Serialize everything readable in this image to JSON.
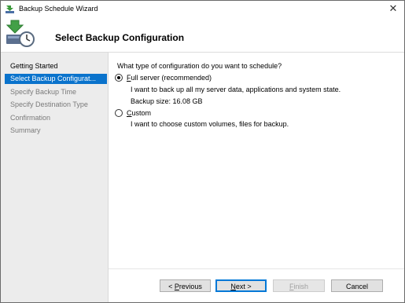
{
  "window": {
    "title": "Backup Schedule Wizard",
    "close_glyph": "✕"
  },
  "header": {
    "title": "Select Backup Configuration",
    "icon": "backup-clock-icon"
  },
  "sidebar": {
    "items": [
      {
        "label": "Getting Started",
        "state": "visited"
      },
      {
        "label": "Select Backup Configurat...",
        "state": "selected"
      },
      {
        "label": "Specify Backup Time",
        "state": "pending"
      },
      {
        "label": "Specify Destination Type",
        "state": "pending"
      },
      {
        "label": "Confirmation",
        "state": "pending"
      },
      {
        "label": "Summary",
        "state": "pending"
      }
    ]
  },
  "main": {
    "question": "What type of configuration do you want to schedule?",
    "options": [
      {
        "label_first": "F",
        "label_rest": "ull server (recommended)",
        "checked": true,
        "description": "I want to back up all my server data, applications and system state.",
        "detail": "Backup size: 16.08 GB"
      },
      {
        "label_first": "C",
        "label_rest": "ustom",
        "checked": false,
        "description": "I want to choose custom volumes, files for backup."
      }
    ]
  },
  "buttons": {
    "previous": {
      "prefix": "< ",
      "accel": "P",
      "rest": "revious"
    },
    "next": {
      "accel": "N",
      "rest": "ext >"
    },
    "finish": {
      "accel": "F",
      "rest": "inish",
      "disabled": true
    },
    "cancel": {
      "label": "Cancel"
    }
  },
  "colors": {
    "selection": "#0a73cc",
    "sidebar_bg": "#ececec",
    "default_button_border": "#0078d7"
  }
}
